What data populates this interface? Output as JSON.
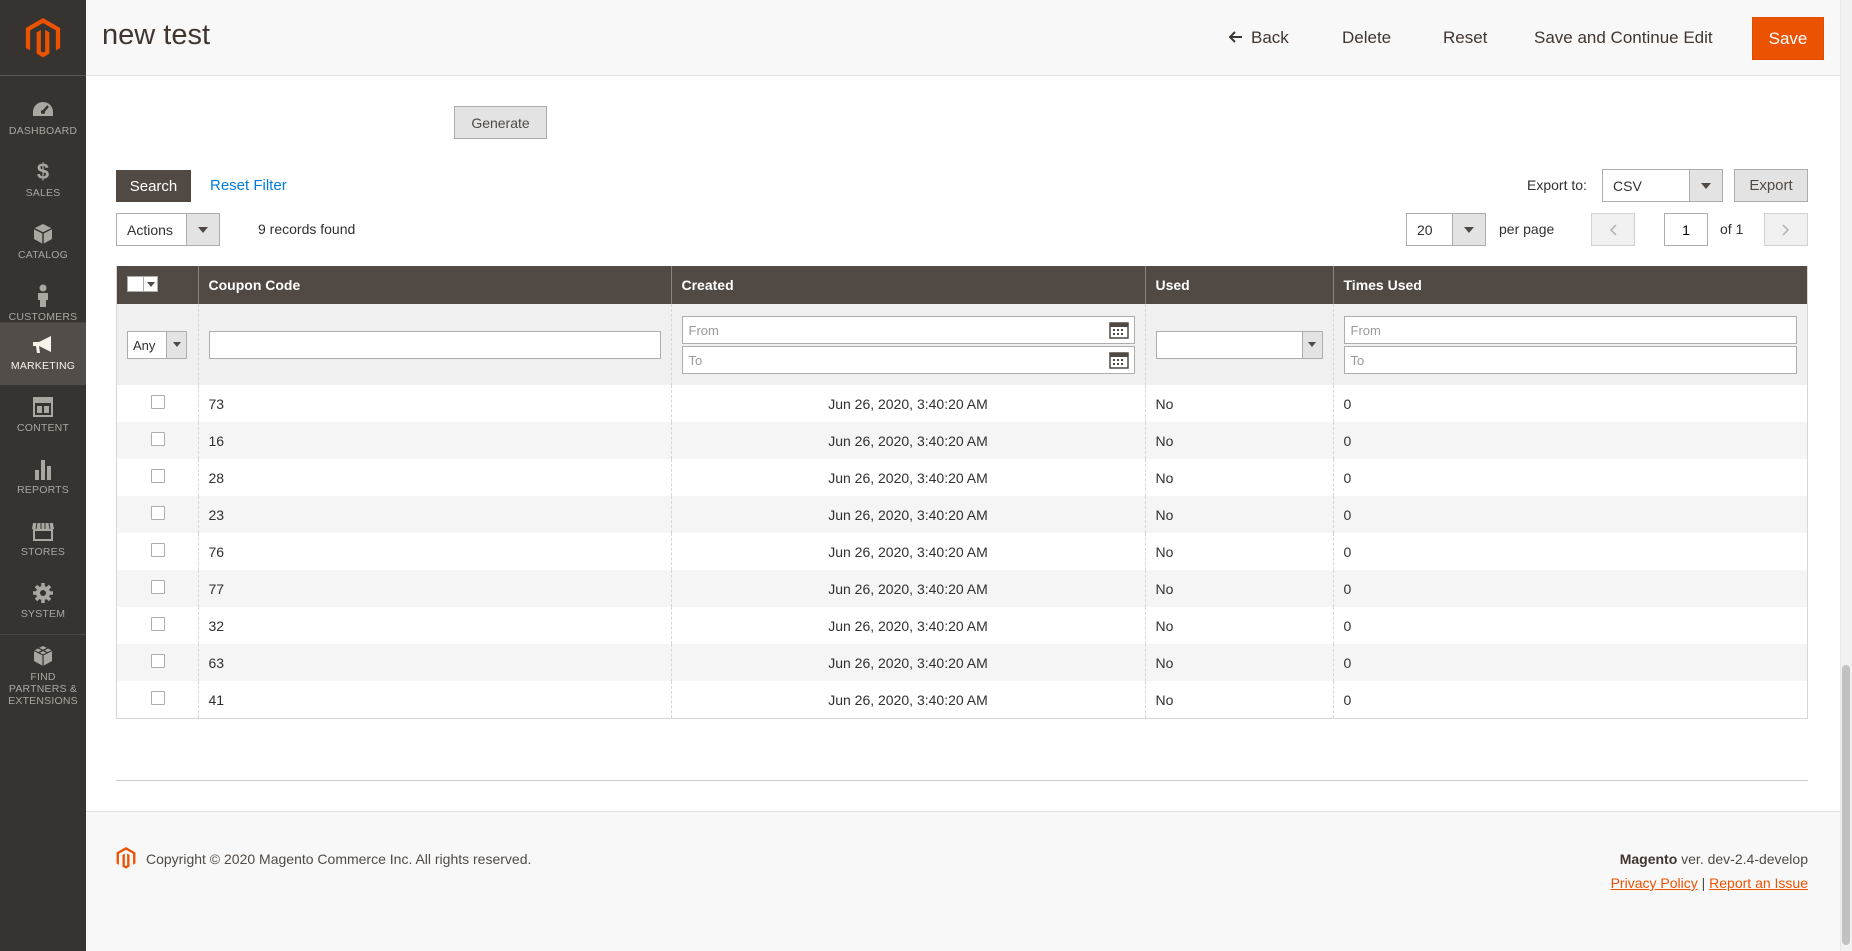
{
  "colors": {
    "sidebar": "#373330",
    "accent": "#eb5202",
    "grid_header": "#514943"
  },
  "sidebar": {
    "items": [
      {
        "label": "DASHBOARD",
        "icon": "dashboard-icon"
      },
      {
        "label": "SALES",
        "icon": "dollar-icon"
      },
      {
        "label": "CATALOG",
        "icon": "box-icon"
      },
      {
        "label": "CUSTOMERS",
        "icon": "person-icon"
      },
      {
        "label": "MARKETING",
        "icon": "megaphone-icon",
        "active": true
      },
      {
        "label": "CONTENT",
        "icon": "layout-icon"
      },
      {
        "label": "REPORTS",
        "icon": "bar-chart-icon"
      },
      {
        "label": "STORES",
        "icon": "store-icon"
      },
      {
        "label": "SYSTEM",
        "icon": "gear-icon"
      },
      {
        "label": "FIND PARTNERS & EXTENSIONS",
        "icon": "cubes-icon"
      }
    ]
  },
  "header": {
    "title": "new test",
    "back": "Back",
    "delete": "Delete",
    "reset": "Reset",
    "save_continue": "Save and Continue Edit",
    "save": "Save"
  },
  "generate_label": "Generate",
  "toolbar": {
    "search": "Search",
    "reset_filter": "Reset Filter",
    "export_to": "Export to:",
    "export_format": "CSV",
    "export": "Export",
    "actions": "Actions",
    "records_found": "9 records found",
    "per_page_value": "20",
    "per_page": "per page",
    "page": "1",
    "of_pages": "of 1"
  },
  "grid": {
    "columns": [
      "Coupon Code",
      "Created",
      "Used",
      "Times Used"
    ],
    "filters": {
      "select_any": "Any",
      "from": "From",
      "to": "To"
    },
    "rows": [
      {
        "code": "73",
        "created": "Jun 26, 2020, 3:40:20 AM",
        "used": "No",
        "times": "0"
      },
      {
        "code": "16",
        "created": "Jun 26, 2020, 3:40:20 AM",
        "used": "No",
        "times": "0"
      },
      {
        "code": "28",
        "created": "Jun 26, 2020, 3:40:20 AM",
        "used": "No",
        "times": "0"
      },
      {
        "code": "23",
        "created": "Jun 26, 2020, 3:40:20 AM",
        "used": "No",
        "times": "0"
      },
      {
        "code": "76",
        "created": "Jun 26, 2020, 3:40:20 AM",
        "used": "No",
        "times": "0"
      },
      {
        "code": "77",
        "created": "Jun 26, 2020, 3:40:20 AM",
        "used": "No",
        "times": "0"
      },
      {
        "code": "32",
        "created": "Jun 26, 2020, 3:40:20 AM",
        "used": "No",
        "times": "0"
      },
      {
        "code": "63",
        "created": "Jun 26, 2020, 3:40:20 AM",
        "used": "No",
        "times": "0"
      },
      {
        "code": "41",
        "created": "Jun 26, 2020, 3:40:20 AM",
        "used": "No",
        "times": "0"
      }
    ]
  },
  "footer": {
    "copyright": "Copyright © 2020 Magento Commerce Inc. All rights reserved.",
    "brand": "Magento",
    "version": " ver. dev-2.4-develop",
    "privacy": "Privacy Policy",
    "separator": "|",
    "report": "Report an Issue"
  }
}
